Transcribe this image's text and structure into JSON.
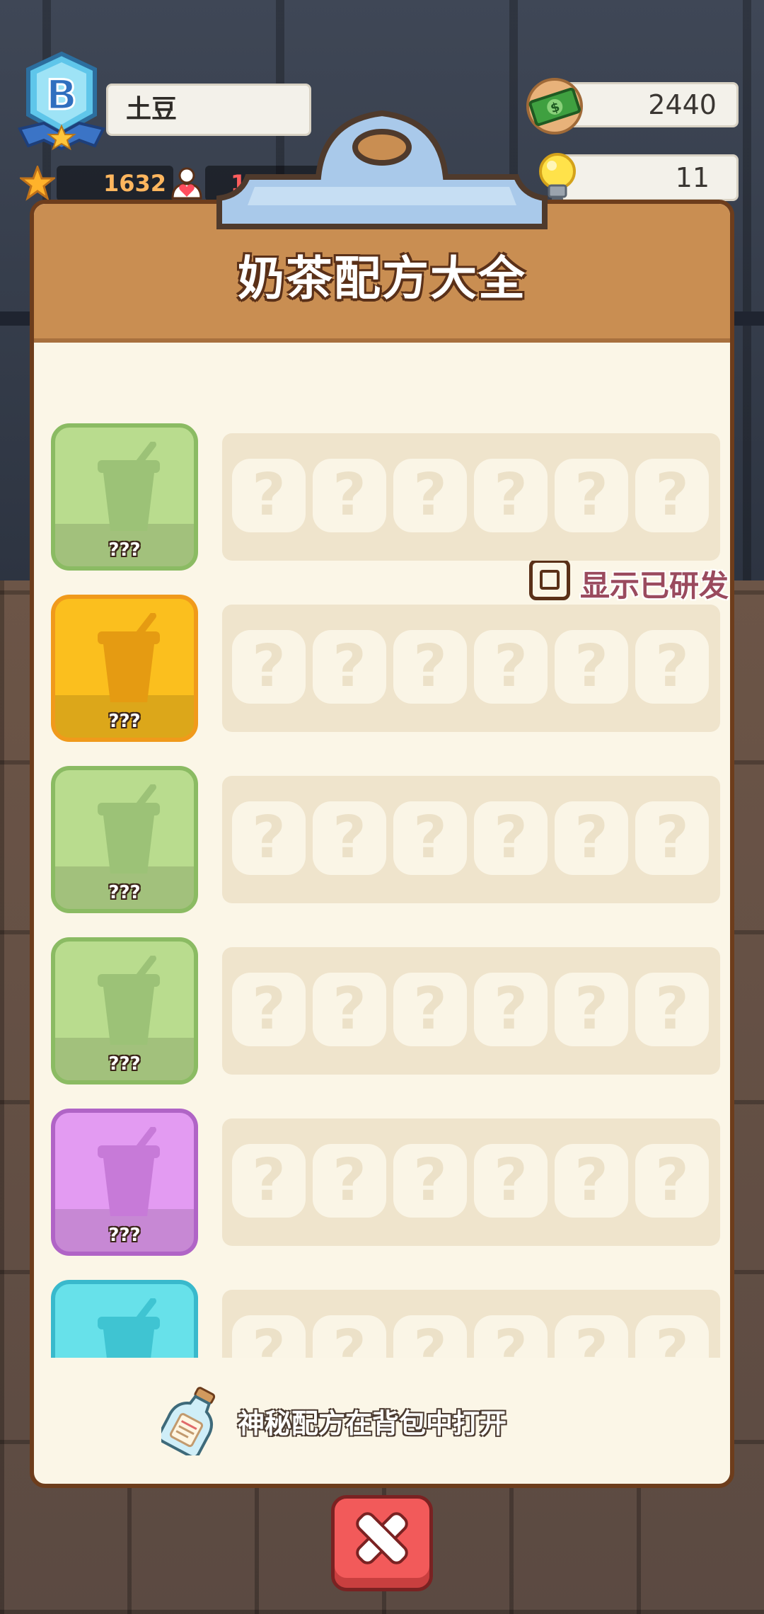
{
  "player": {
    "level_letter": "B",
    "name": "土豆",
    "stars": "1632",
    "fans": "15.67万"
  },
  "currency": {
    "money": "2440",
    "ideas": "11"
  },
  "panel": {
    "title": "奶茶配方大全",
    "show_researched_label": "显示已研发",
    "show_researched_checked": false,
    "footer_note": "神秘配方在背包中打开"
  },
  "recipes": [
    {
      "name": "???",
      "color": "#b9dc8e",
      "border": "#8bbb63",
      "cup": "#9cc277",
      "slots": [
        "?",
        "?",
        "?",
        "?",
        "?",
        "?"
      ]
    },
    {
      "name": "???",
      "color": "#fbbf1e",
      "border": "#f09a1b",
      "cup": "#e59b12",
      "slots": [
        "?",
        "?",
        "?",
        "?",
        "?",
        "?"
      ]
    },
    {
      "name": "???",
      "color": "#b9dc8e",
      "border": "#8bbb63",
      "cup": "#9cc277",
      "slots": [
        "?",
        "?",
        "?",
        "?",
        "?",
        "?"
      ]
    },
    {
      "name": "???",
      "color": "#b9dc8e",
      "border": "#8bbb63",
      "cup": "#9cc277",
      "slots": [
        "?",
        "?",
        "?",
        "?",
        "?",
        "?"
      ]
    },
    {
      "name": "???",
      "color": "#e39bf2",
      "border": "#b064c6",
      "cup": "#c77ad8",
      "slots": [
        "?",
        "?",
        "?",
        "?",
        "?",
        "?"
      ]
    },
    {
      "name": "???",
      "color": "#67e1ea",
      "border": "#39b9cc",
      "cup": "#3fc4d2",
      "slots": [
        "?",
        "?",
        "?",
        "?",
        "?",
        "?"
      ]
    }
  ],
  "icons": {
    "level": "level-badge-icon",
    "star": "star-icon",
    "fans": "heart-person-icon",
    "money": "cash-icon",
    "ideas": "lightbulb-icon",
    "bottle": "message-bottle-icon",
    "close": "close-icon"
  }
}
